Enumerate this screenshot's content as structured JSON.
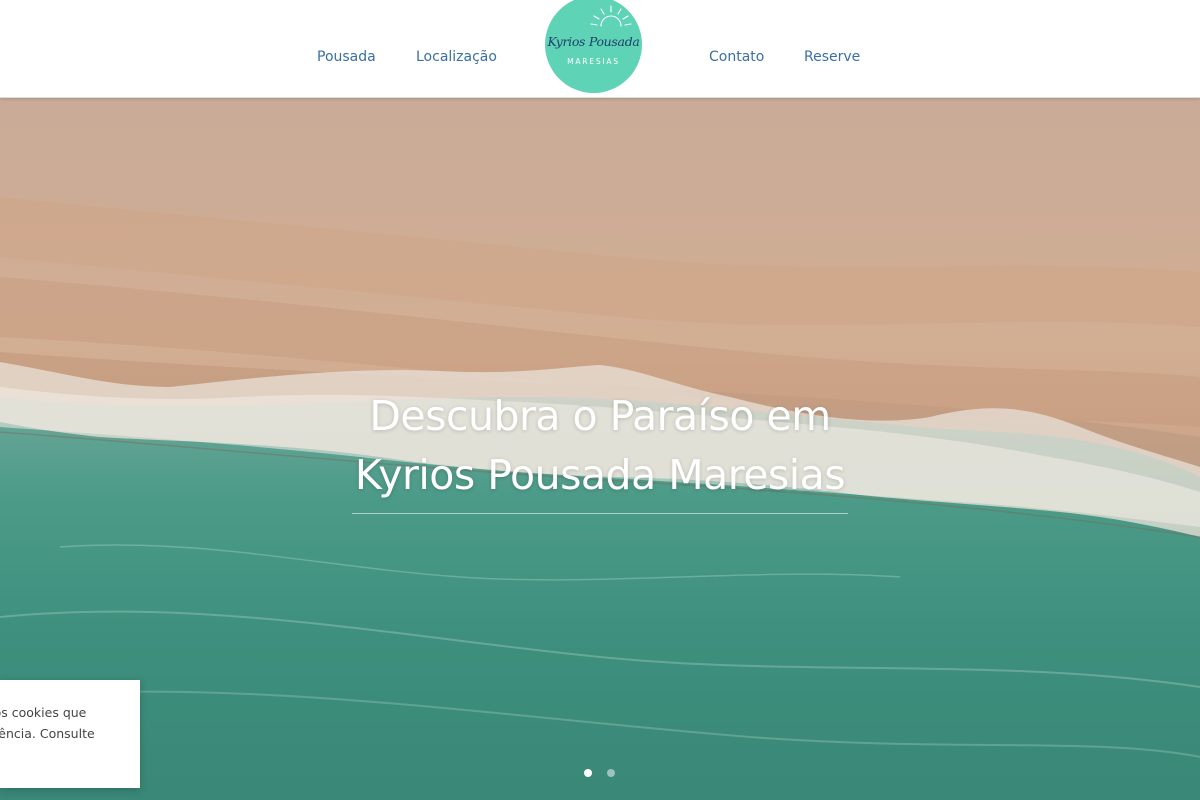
{
  "nav": {
    "left_items": [
      {
        "label": "Pousada"
      },
      {
        "label": "Localização"
      }
    ],
    "right_items": [
      {
        "label": "Contato"
      },
      {
        "label": "Reserve"
      }
    ],
    "link_color": "#3a6fa5"
  },
  "logo": {
    "script_text": "Kyrios Pousada",
    "subtitle": "MARESIAS",
    "icon": "sun-icon",
    "background_color": "#5fd3b5"
  },
  "hero": {
    "title_line1": "Descubra o Paraíso em",
    "title_line2": "Kyrios Pousada Maresias",
    "image": "aerial-beach-image",
    "carousel": {
      "slide_count": 2,
      "active_index": 0
    }
  },
  "cookie_banner": {
    "line1": "a os cookies que",
    "line2": "eriência. Consulte"
  }
}
